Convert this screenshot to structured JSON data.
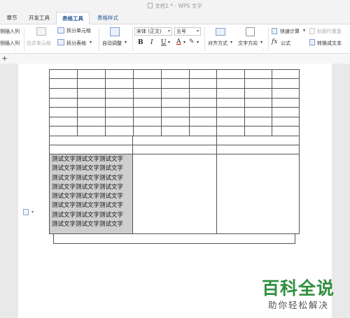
{
  "window": {
    "title": "文档1 * - WPS 文字"
  },
  "tabs": [
    {
      "label": "章节"
    },
    {
      "label": "开发工具"
    },
    {
      "label": "表格工具"
    },
    {
      "label": "表格样式"
    }
  ],
  "ribbon": {
    "insert_col_left": "侧插入列",
    "insert_col_right": "侧插入列",
    "merge_cells": "合并单元格",
    "split_cells": "拆分单元格",
    "split_table": "拆分表格",
    "auto_fit": "自动调整",
    "font_name": "宋体 (正文)",
    "font_size": "五号",
    "bold": "B",
    "italic": "I",
    "underline": "U",
    "font_color": "A",
    "align": "对齐方式",
    "text_direction": "文字方向",
    "quick_calc": "快速计算",
    "repeat_header": "标题行重复",
    "formula": "公式",
    "convert_text": "转换成文本",
    "fx": "fx"
  },
  "quickbar": {
    "plus": "+"
  },
  "table": {
    "cell_lines": [
      "测试文字测试文字测试文字",
      "测试文字测试文字测试文字",
      "测试文字测试文字测试文字",
      "测试文字测试文字测试文字",
      "测试文字测试文字测试文字",
      "测试文字测试文字测试文字",
      "测试文字测试文字测试文字",
      "测试文字测试文字测试文字"
    ]
  },
  "watermark": {
    "brand": "百科全说",
    "slogan": "助你轻松解决"
  },
  "colors": {
    "accent": "#2b5797",
    "brand": "#2f8f3e",
    "selection": "#cfcfcf"
  }
}
